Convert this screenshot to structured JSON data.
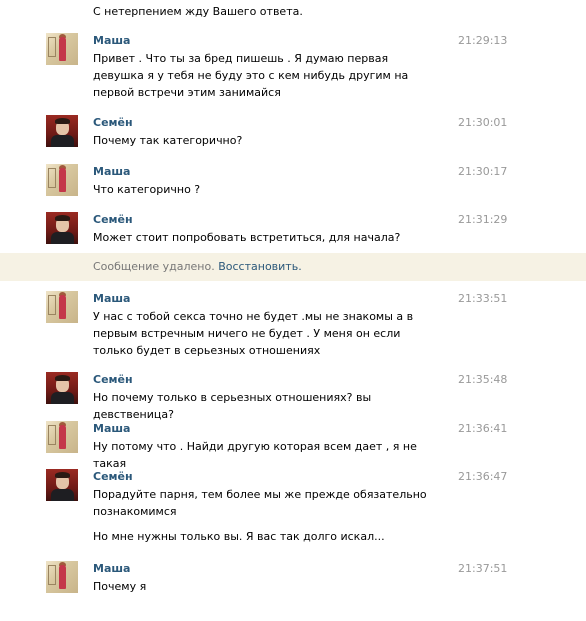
{
  "top_message": "С нетерпением жду Вашего ответа.",
  "messages": [
    {
      "sender": "Маша",
      "time": "21:29:13",
      "text": "Привет . Что ты за бред пишешь . Я думаю первая девушка я у тебя не буду это с кем нибудь другим на первой встречи этим занимайся"
    },
    {
      "sender": "Семён",
      "time": "21:30:01",
      "text": "Почему так категорично?"
    },
    {
      "sender": "Маша",
      "time": "21:30:17",
      "text": "Что категорично ?"
    },
    {
      "sender": "Семён",
      "time": "21:31:29",
      "text": "Может стоит попробовать встретиться, для начала?"
    },
    {
      "sender": "Маша",
      "time": "21:33:51",
      "text": "У нас с тобой секса точно не будет .мы не знакомы а в первым встречным ничего не будет . У меня он если только будет в серьезных отношениях"
    },
    {
      "sender": "Семён",
      "time": "21:35:48",
      "text": "Но почему только в серьезных отношениях? вы девственица?"
    },
    {
      "sender": "Маша",
      "time": "21:36:41",
      "text": "Ну потому что . Найди другую которая всем дает , я не такая"
    },
    {
      "sender": "Семён",
      "time": "21:36:47",
      "text": "Порадуйте парня, тем более мы же прежде обязательно познакомимся",
      "extra_text": "Но мне нужны только вы. Я вас так долго искал..."
    },
    {
      "sender": "Маша",
      "time": "21:37:51",
      "text": "Почему я"
    }
  ],
  "deleted_notice": {
    "text": "Сообщение удалено.",
    "restore_label": "Восстановить."
  },
  "colors": {
    "name": "#2b587a",
    "time": "#999999",
    "deleted_bg": "#f6f2e4"
  }
}
